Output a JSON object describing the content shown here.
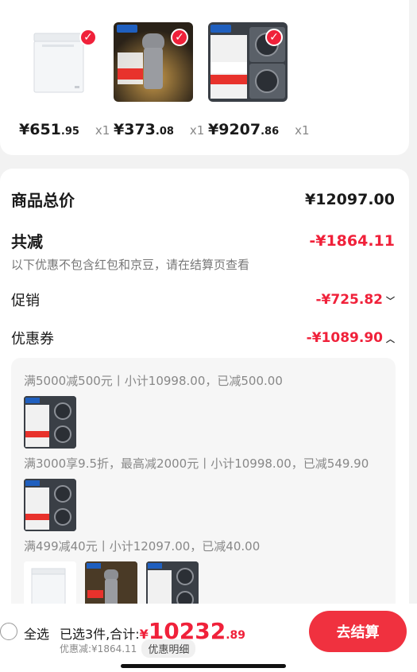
{
  "products": [
    {
      "name": "chest-freezer",
      "price_main": "¥651",
      "price_dec": ".95",
      "qty": "x1"
    },
    {
      "name": "water-purifier",
      "price_main": "¥373",
      "price_dec": ".08",
      "qty": "x1"
    },
    {
      "name": "washer-dryer-set",
      "price_main": "¥9207",
      "price_dec": ".86",
      "qty": "x1"
    }
  ],
  "product_badges": {
    "brand": "Haier",
    "purifier_price": "400",
    "washer_price": "10998"
  },
  "summary": {
    "total_label": "商品总价",
    "total_value": "¥12097.00",
    "discount_label": "共减",
    "discount_value": "-¥1864.11",
    "note": "以下优惠不包含红包和京豆，请在结算页查看",
    "promo_label": "促销",
    "promo_value": "-¥725.82",
    "coupon_label": "优惠券",
    "coupon_value": "-¥1089.90"
  },
  "coupons": [
    {
      "text": "满5000减500元丨小计10998.00，已减500.00"
    },
    {
      "text": "满3000享9.5折，最高减2000元丨小计10998.00，已减549.90"
    },
    {
      "text": "满499减40元丨小计12097.00，已减40.00"
    }
  ],
  "bottom": {
    "select_all": "全选",
    "selected_info": "已选3件,合计:",
    "yen": "¥",
    "total_int": "10232",
    "total_dec": ".89",
    "discount_line": "优惠减:¥1864.11",
    "detail_label": "优惠明细",
    "checkout_label": "去结算"
  },
  "colors": {
    "accent": "#f0213a",
    "button": "#f0313f"
  }
}
